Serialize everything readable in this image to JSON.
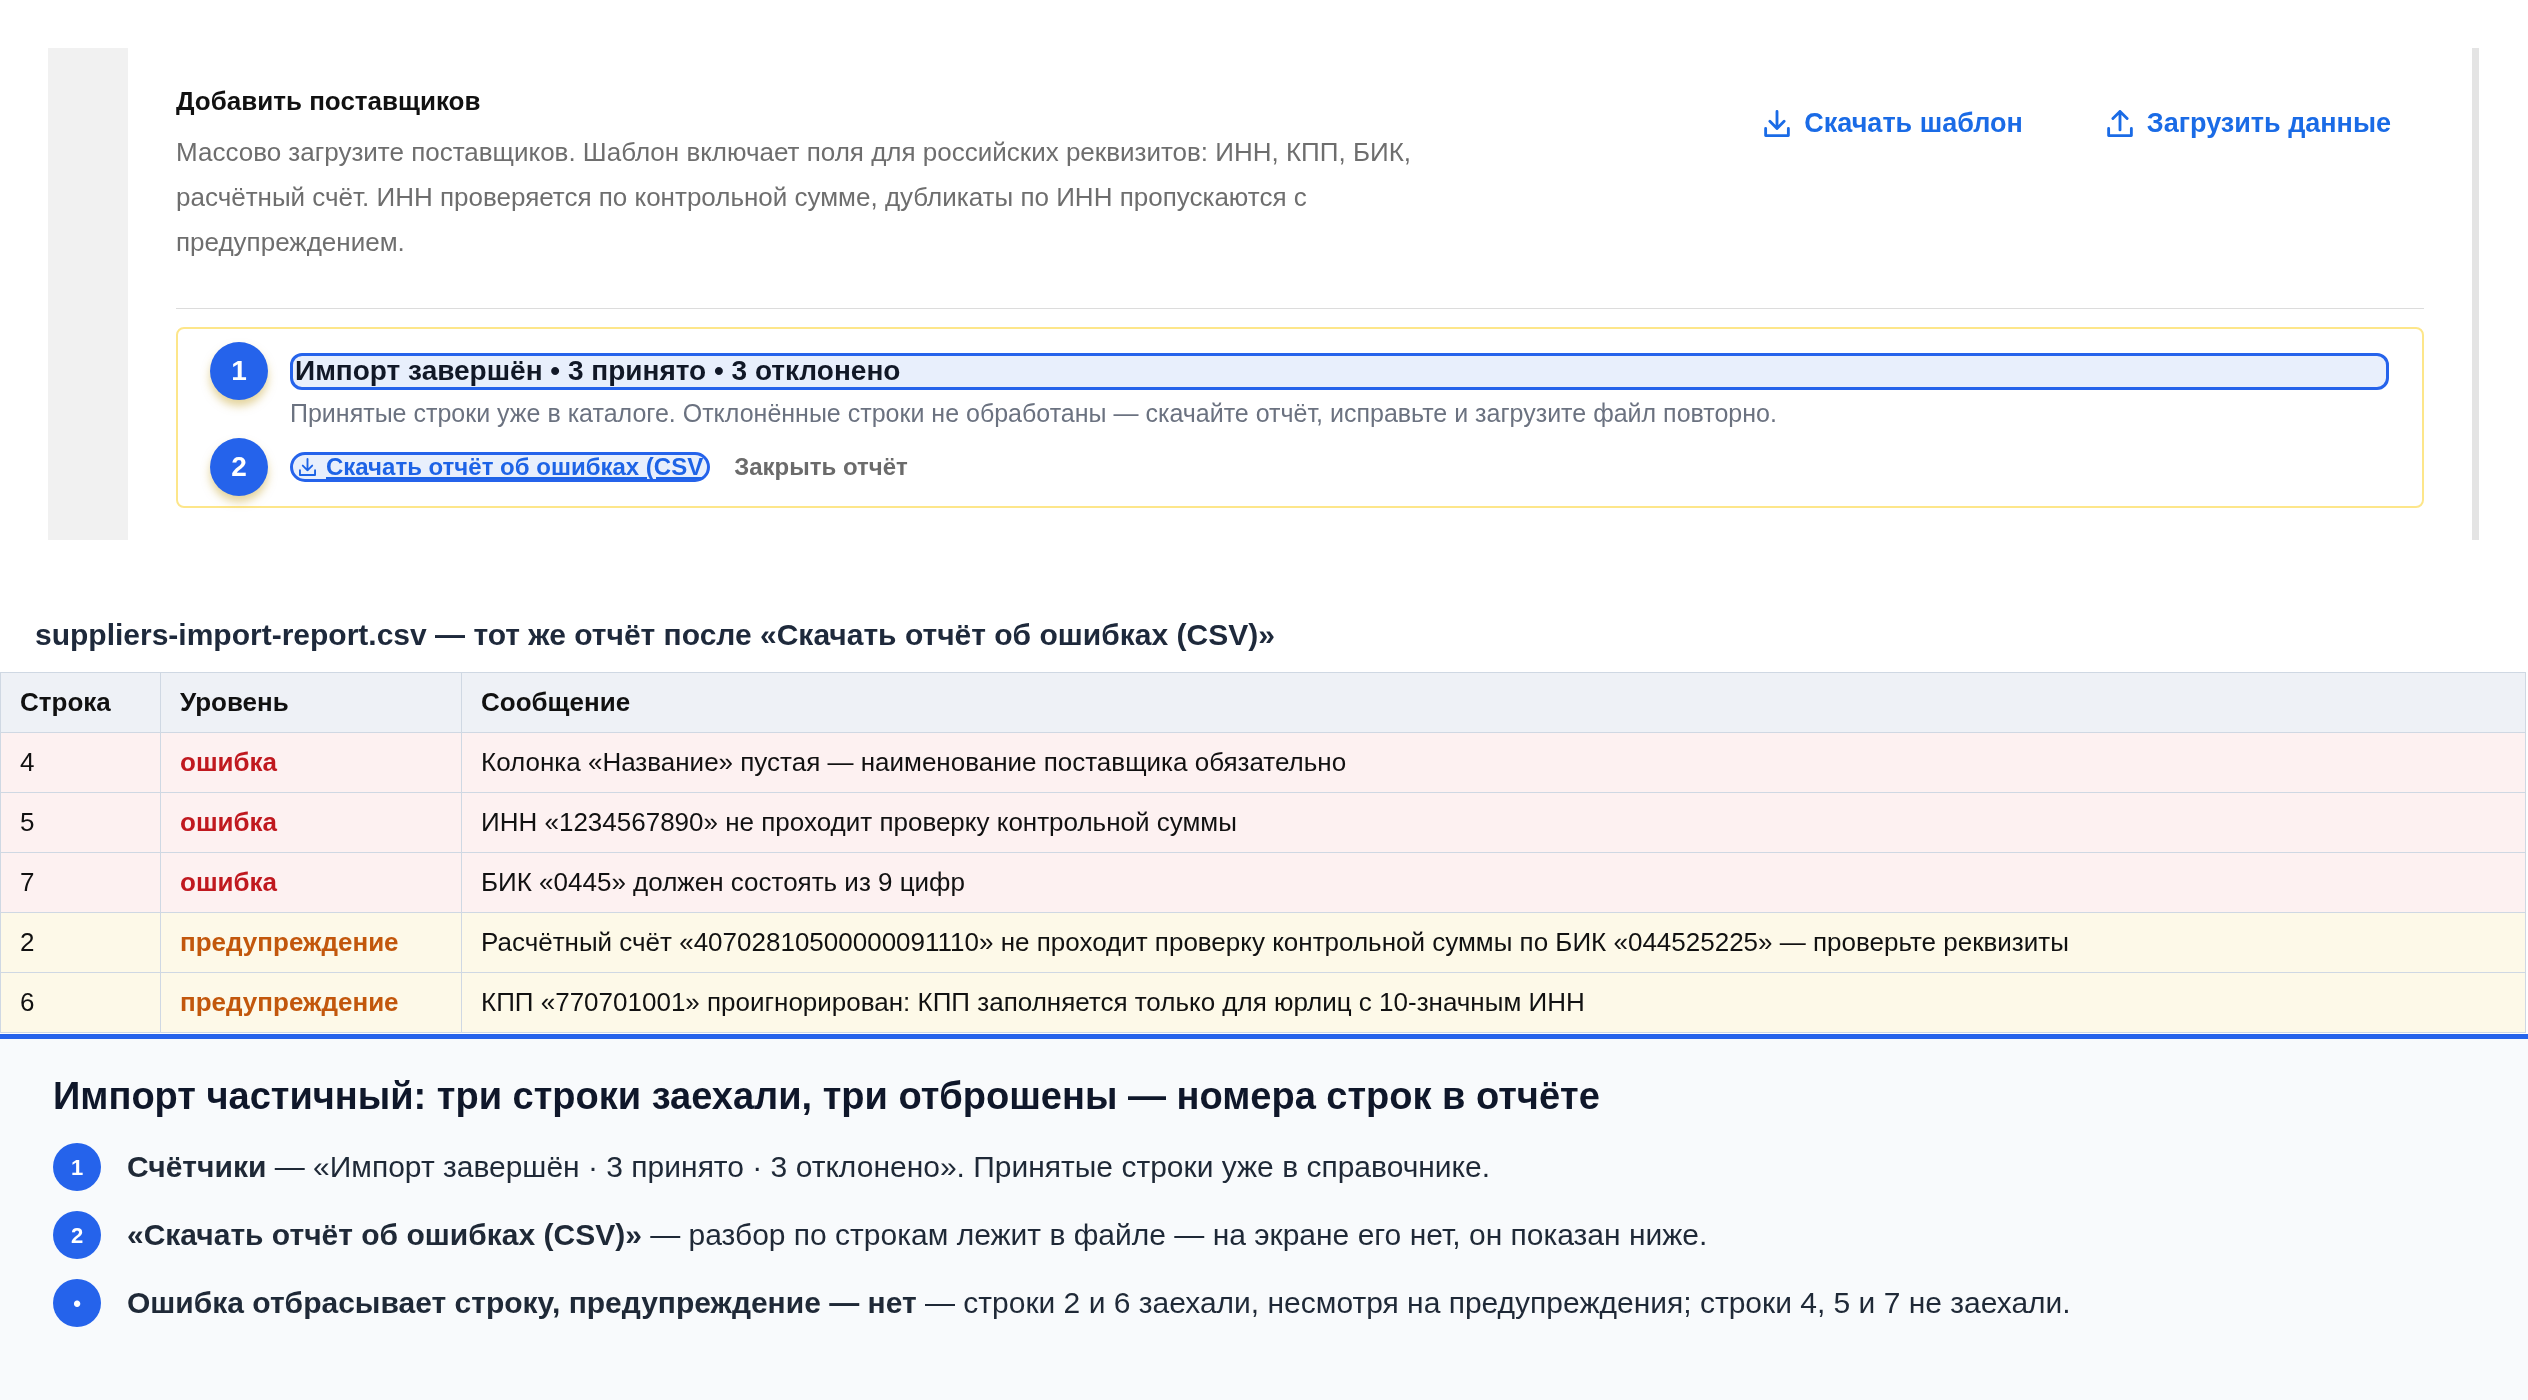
{
  "card": {
    "title": "Добавить поставщиков",
    "description": "Массово загрузите поставщиков. Шаблон включает поля для российских реквизитов: ИНН, КПП, БИК, расчётный счёт. ИНН проверяется по контрольной сумме, дубликаты по ИНН пропускаются с предупреждением.",
    "actions": [
      {
        "label": "Скачать шаблон",
        "kind": "download"
      },
      {
        "label": "Загрузить данные",
        "kind": "upload"
      }
    ],
    "import_result": {
      "summary": {
        "callout": "1",
        "text": "Импорт завершён • 3 принято • 3 отклонено",
        "highlighted": true
      },
      "note": "Принятые строки уже в каталоге. Отклонённые строки не обработаны — скачайте отчёт, исправьте и загрузите файл повторно.",
      "download_button": {
        "callout": "2",
        "label": "Скачать отчёт об ошибках (CSV",
        "highlighted": true
      },
      "close_link": "Закрыть отчёт"
    }
  },
  "report": {
    "caption": "suppliers-import-report.csv — тот же отчёт после «Скачать отчёт об ошибках (CSV)»",
    "columns": [
      "Строка",
      "Уровень",
      "Сообщение"
    ],
    "rows": [
      {
        "kind": "error",
        "cells": [
          "4",
          "ошибка",
          "Колонка «Название» пустая — наименование поставщика обязательно"
        ]
      },
      {
        "kind": "error",
        "cells": [
          "5",
          "ошибка",
          "ИНН «1234567890» не проходит проверку контрольной суммы"
        ]
      },
      {
        "kind": "error",
        "cells": [
          "7",
          "ошибка",
          "БИК «0445» должен состоять из 9 цифр"
        ]
      },
      {
        "kind": "warning",
        "cells": [
          "2",
          "предупреждение",
          "Расчётный счёт «40702810500000091110» не проходит проверку контрольной суммы по БИК «044525225» — проверьте реквизиты"
        ]
      },
      {
        "kind": "warning",
        "cells": [
          "6",
          "предупреждение",
          "КПП «770701001» проигнорирован: КПП заполняется только для юрлиц с 10-значным ИНН"
        ]
      }
    ]
  },
  "explanation": {
    "title": "Импорт частичный: три строки заехали, три отброшены — номера строк в отчёте",
    "items": [
      {
        "marker": "1",
        "text": "**Счётчики** — «Импорт завершён · 3 принято · 3 отклонено». Принятые строки уже в справочнике."
      },
      {
        "marker": "2",
        "text": "**«Скачать отчёт об ошибках (CSV)»** — разбор по строкам лежит в файле — на экране его нет, он показан ниже."
      },
      {
        "marker": "•",
        "text": "**Ошибка отбрасывает строку, предупреждение — нет** — строки 2 и 6 заехали, несмотря на предупреждения; строки 4, 5 и 7 не заехали."
      }
    ]
  }
}
